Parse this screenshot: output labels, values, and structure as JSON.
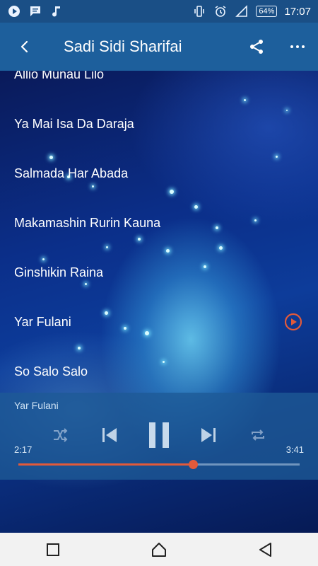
{
  "status_bar": {
    "battery": "64%",
    "time": "17:07",
    "icons_left": [
      "play-circle-icon",
      "message-icon",
      "music-note-icon"
    ],
    "icons_right": [
      "vibrate-icon",
      "alarm-icon",
      "signal-icon",
      "battery-icon"
    ]
  },
  "app_bar": {
    "title": "Sadi Sidi Sharifai",
    "icons": [
      "back-arrow-icon",
      "share-icon",
      "more-icon"
    ]
  },
  "songs": [
    {
      "title": "Allio Munau Lilo"
    },
    {
      "title": "Ya Mai Isa Da Daraja"
    },
    {
      "title": "Salmada Har Abada"
    },
    {
      "title": "Makamashin Rurin Kauna"
    },
    {
      "title": "Ginshikin Raina"
    },
    {
      "title": "Yar Fulani",
      "playing": true
    },
    {
      "title": "So Salo Salo"
    }
  ],
  "player": {
    "now_playing": "Yar Fulani",
    "current_time": "2:17",
    "total_time": "3:41",
    "progress": 0.62,
    "controls": [
      "shuffle-icon",
      "previous-icon",
      "pause-icon",
      "next-icon",
      "repeat-icon"
    ]
  },
  "nav_bar": {
    "buttons": [
      "recents-icon",
      "home-icon",
      "back-icon"
    ]
  },
  "colors": {
    "status_bar": "#1a4f86",
    "app_bar": "#1d5f9c",
    "accent": "#e25a3a"
  }
}
